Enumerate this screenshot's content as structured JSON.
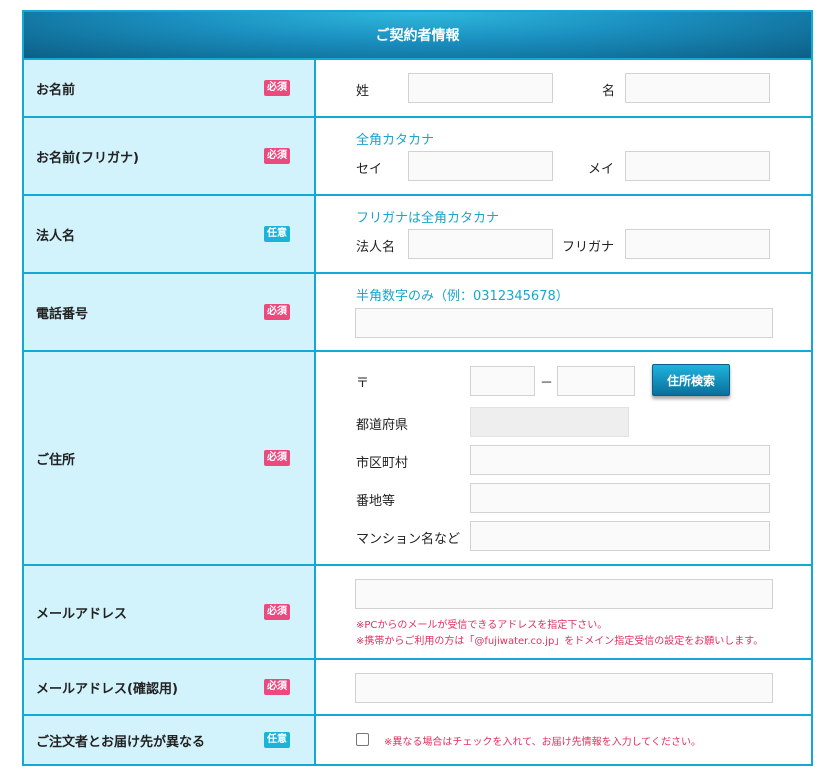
{
  "header": {
    "title": "ご契約者情報"
  },
  "badges": {
    "required": "必須",
    "optional": "任意"
  },
  "rows": {
    "name": {
      "label": "お名前",
      "last_label": "姓",
      "first_label": "名",
      "last_value": "",
      "first_value": ""
    },
    "kana": {
      "label": "お名前(フリガナ)",
      "hint": "全角カタカナ",
      "last_label": "セイ",
      "first_label": "メイ",
      "last_value": "",
      "first_value": ""
    },
    "corp": {
      "label": "法人名",
      "hint": "フリガナは全角カタカナ",
      "name_label": "法人名",
      "kana_label": "フリガナ",
      "name_value": "",
      "kana_value": ""
    },
    "phone": {
      "label": "電話番号",
      "hint": "半角数字のみ（例：0312345678）",
      "value": ""
    },
    "address": {
      "label": "ご住所",
      "postal_mark": "〒",
      "dash": "－",
      "search_button": "住所検索",
      "prefecture_label": "都道府県",
      "city_label": "市区町村",
      "street_label": "番地等",
      "building_label": "マンション名など",
      "postal1": "",
      "postal2": "",
      "prefecture": "",
      "city": "",
      "street": "",
      "building": ""
    },
    "email": {
      "label": "メールアドレス",
      "value": "",
      "note1": "※PCからのメールが受信できるアドレスを指定下さい。",
      "note2": "※携帯からご利用の方は「@fujiwater.co.jp」をドメイン指定受信の設定をお願いします。"
    },
    "email_confirm": {
      "label": "メールアドレス(確認用)",
      "value": ""
    },
    "delivery": {
      "label": "ご注文者とお届け先が異なる",
      "note": "※異なる場合はチェックを入れて、お届け先情報を入力してください。"
    }
  },
  "colors": {
    "border": "#14a8d6",
    "label_bg": "#d2f3fc",
    "required": "#ec4a7f",
    "optional": "#1bb4d9",
    "hint": "#1aa6cc",
    "note": "#e2305f"
  }
}
